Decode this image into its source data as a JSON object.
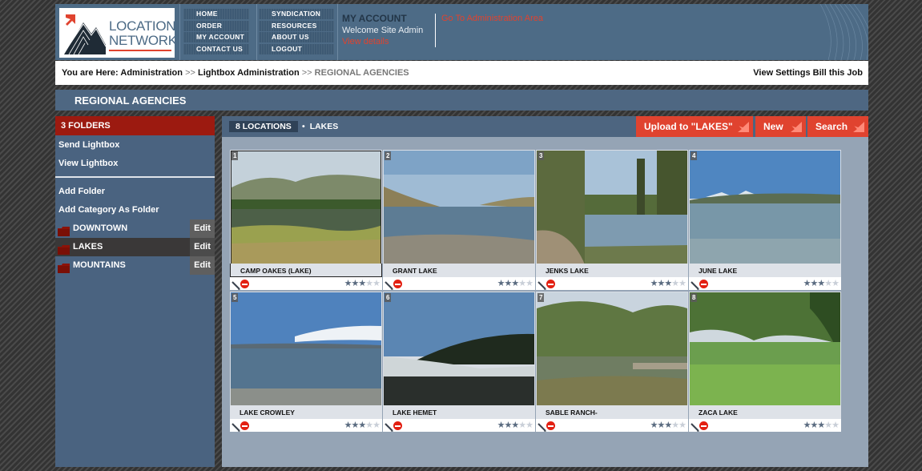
{
  "brand": {
    "line1": "LOCATION",
    "line2": "NETWORK"
  },
  "nav": {
    "col1": [
      "HOME",
      "ORDER",
      "MY ACCOUNT",
      "CONTACT US"
    ],
    "col2": [
      "SYNDICATION",
      "RESOURCES",
      "ABOUT US",
      "LOGOUT"
    ]
  },
  "account": {
    "title": "MY ACCOUNT",
    "welcome": "Welcome Site Admin",
    "view_details": "View details",
    "admin_link": "Go To Administration Area"
  },
  "breadcrumb": {
    "prefix": "You are Here:",
    "items": [
      "Administration",
      "Lightbox Administration"
    ],
    "current": "REGIONAL AGENCIES",
    "separator": ">>",
    "right_links": [
      "View Settings",
      "Bill this Job"
    ]
  },
  "section": {
    "title": "REGIONAL AGENCIES"
  },
  "sidebar": {
    "folders_header": "3 FOLDERS",
    "links_top": [
      "Send Lightbox",
      "View Lightbox"
    ],
    "links_bottom": [
      "Add Folder",
      "Add Category As Folder"
    ],
    "edit_label": "Edit",
    "folders": [
      {
        "name": "DOWNTOWN",
        "active": false
      },
      {
        "name": "LAKES",
        "active": true
      },
      {
        "name": "MOUNTAINS",
        "active": false
      }
    ]
  },
  "main": {
    "count_label": "8 LOCATIONS",
    "category": "LAKES",
    "buttons": {
      "upload": "Upload to \"LAKES\"",
      "new": "New",
      "search": "Search"
    }
  },
  "locations": [
    {
      "num": "1",
      "name": "CAMP OAKES (LAKE)",
      "rating": 3,
      "selected": true
    },
    {
      "num": "2",
      "name": "GRANT LAKE",
      "rating": 3,
      "selected": false
    },
    {
      "num": "3",
      "name": "JENKS LAKE",
      "rating": 3,
      "selected": false
    },
    {
      "num": "4",
      "name": "JUNE LAKE",
      "rating": 3,
      "selected": false
    },
    {
      "num": "5",
      "name": "LAKE CROWLEY",
      "rating": 3,
      "selected": false
    },
    {
      "num": "6",
      "name": "LAKE HEMET",
      "rating": 3,
      "selected": false
    },
    {
      "num": "7",
      "name": "SABLE RANCH-",
      "rating": 3,
      "selected": false
    },
    {
      "num": "8",
      "name": "ZACA LAKE",
      "rating": 3,
      "selected": false
    }
  ],
  "colors": {
    "accent": "#e0432f",
    "header": "#4d6b86",
    "sidebar": "#4a6380",
    "folders_header": "#9c1a10"
  }
}
